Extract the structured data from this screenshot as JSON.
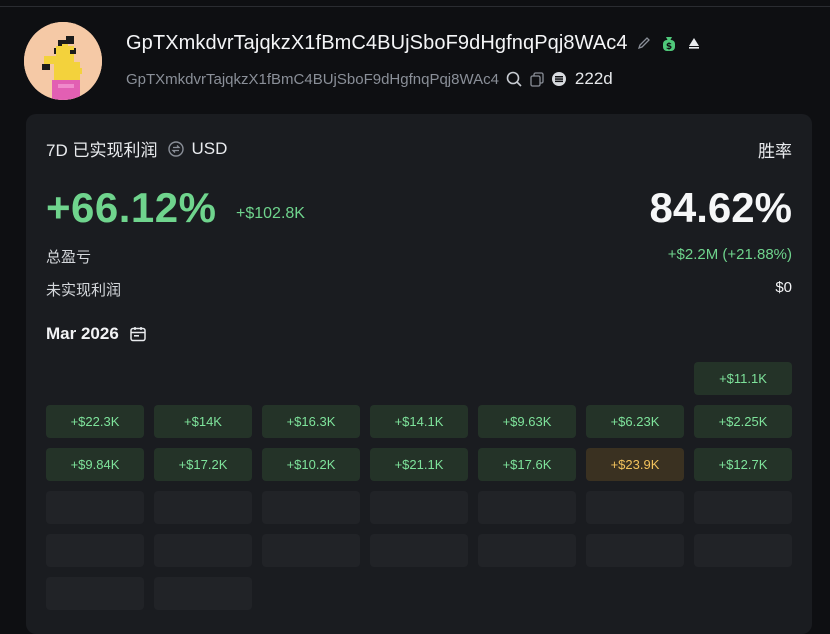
{
  "profile": {
    "wallet_name": "GpTXmkdvrTajqkzX1fBmC4BUjSboF9dHgfnqPqj8WAc4",
    "wallet_address": "GpTXmkdvrTajqkzX1fBmC4BUjSboF9dHgfnqPqj8WAc4",
    "age": "222d"
  },
  "stats": {
    "period_label": "7D 已实现利润",
    "currency": "USD",
    "winrate_label": "胜率",
    "realized_pnl_pct": "+66.12%",
    "realized_pnl_abs": "+$102.8K",
    "winrate": "84.62%",
    "total_pnl_label": "总盈亏",
    "total_pnl_value": "+$2.2M (+21.88%)",
    "unrealized_label": "未实现利润",
    "unrealized_value": "$0"
  },
  "calendar": {
    "month": "Mar 2026",
    "rows": [
      [
        null,
        null,
        null,
        null,
        null,
        null,
        {
          "label": "+$11.1K",
          "kind": "gain"
        }
      ],
      [
        {
          "label": "+$22.3K",
          "kind": "gain"
        },
        {
          "label": "+$14K",
          "kind": "gain"
        },
        {
          "label": "+$16.3K",
          "kind": "gain"
        },
        {
          "label": "+$14.1K",
          "kind": "gain"
        },
        {
          "label": "+$9.63K",
          "kind": "gain"
        },
        {
          "label": "+$6.23K",
          "kind": "gain"
        },
        {
          "label": "+$2.25K",
          "kind": "gain"
        }
      ],
      [
        {
          "label": "+$9.84K",
          "kind": "gain"
        },
        {
          "label": "+$17.2K",
          "kind": "gain"
        },
        {
          "label": "+$10.2K",
          "kind": "gain"
        },
        {
          "label": "+$21.1K",
          "kind": "gain"
        },
        {
          "label": "+$17.6K",
          "kind": "gain"
        },
        {
          "label": "+$23.9K",
          "kind": "best"
        },
        {
          "label": "+$12.7K",
          "kind": "gain"
        }
      ],
      [
        {
          "label": "",
          "kind": "empty"
        },
        {
          "label": "",
          "kind": "empty"
        },
        {
          "label": "",
          "kind": "empty"
        },
        {
          "label": "",
          "kind": "empty"
        },
        {
          "label": "",
          "kind": "empty"
        },
        {
          "label": "",
          "kind": "empty"
        },
        {
          "label": "",
          "kind": "empty"
        }
      ],
      [
        {
          "label": "",
          "kind": "empty"
        },
        {
          "label": "",
          "kind": "empty"
        },
        {
          "label": "",
          "kind": "empty"
        },
        {
          "label": "",
          "kind": "empty"
        },
        {
          "label": "",
          "kind": "empty"
        },
        {
          "label": "",
          "kind": "empty"
        },
        {
          "label": "",
          "kind": "empty"
        }
      ],
      [
        {
          "label": "",
          "kind": "empty"
        },
        {
          "label": "",
          "kind": "empty"
        },
        null,
        null,
        null,
        null,
        null
      ]
    ]
  },
  "icons": {
    "edit": "pencil-icon",
    "money_bag": "money-bag-icon",
    "triangle": "triangle-up-icon",
    "search": "search-icon",
    "copy": "copy-icon",
    "chain": "chain-badge-icon",
    "currency_swap": "currency-swap-icon",
    "calendar": "calendar-icon"
  },
  "colors": {
    "positive": "#6fd48d",
    "best_day": "#f2c25c",
    "card_bg": "#1a1c20",
    "page_bg": "#0e0f12"
  }
}
